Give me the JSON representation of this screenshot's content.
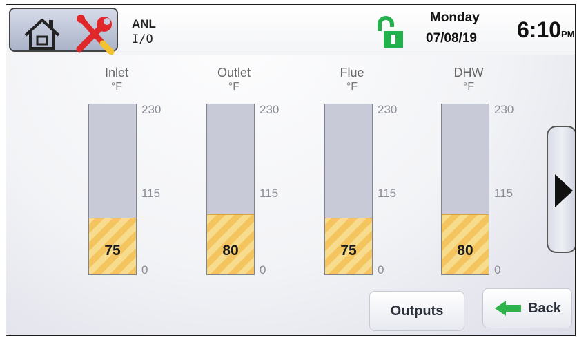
{
  "header": {
    "mode_line1": "ANL",
    "mode_line2": "I/O",
    "day": "Monday",
    "date": "07/08/19",
    "time": "6:10",
    "ampm": "PM",
    "icons": [
      "home-icon",
      "tools-icon",
      "unlocked-icon"
    ]
  },
  "gauges": [
    {
      "label": "Inlet",
      "unit": "°F",
      "value": "75",
      "fill_fraction": 0.33
    },
    {
      "label": "Outlet",
      "unit": "°F",
      "value": "80",
      "fill_fraction": 0.35
    },
    {
      "label": "Flue",
      "unit": "°F",
      "value": "75",
      "fill_fraction": 0.33
    },
    {
      "label": "DHW",
      "unit": "°F",
      "value": "80",
      "fill_fraction": 0.35
    }
  ],
  "scale": {
    "max": "230",
    "mid": "115",
    "min": "0"
  },
  "buttons": {
    "outputs": "Outputs",
    "back": "Back",
    "next_icon": "right-arrow-icon"
  },
  "colors": {
    "fill": "#f4c55e",
    "lock": "#22b14c",
    "back_arrow": "#2db34a",
    "tools_red": "#e0272a"
  }
}
